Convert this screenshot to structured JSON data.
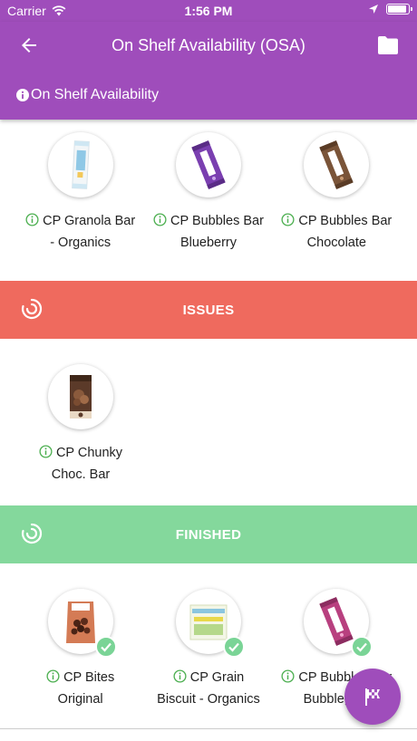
{
  "status_bar": {
    "carrier": "Carrier",
    "time": "1:56 PM",
    "battery_level": 0.9
  },
  "header": {
    "title": "On Shelf Availability (OSA)",
    "subtitle": "On Shelf Availability",
    "icons": [
      "back-arrow-icon",
      "folder-icon",
      "info-icon"
    ]
  },
  "pending": {
    "products": [
      {
        "line1": "CP Granola Bar",
        "line2": "- Organics",
        "image": "granola-bar-image"
      },
      {
        "line1": "CP Bubbles Bar",
        "line2": "Blueberry",
        "image": "bubbles-blueberry-image"
      },
      {
        "line1": "CP Bubbles Bar",
        "line2": "Chocolate",
        "image": "bubbles-chocolate-image"
      }
    ]
  },
  "issues": {
    "label": "ISSUES",
    "color": "#ef6a5e",
    "products": [
      {
        "line1": "CP Chunky",
        "line2": "Choc. Bar",
        "image": "chunky-choc-image"
      }
    ]
  },
  "finished": {
    "label": "FINISHED",
    "color": "#84d89c",
    "products": [
      {
        "line1": "CP Bites",
        "line2": "Original",
        "image": "bites-image"
      },
      {
        "line1": "CP Grain",
        "line2": "Biscuit - Organics",
        "image": "grain-biscuit-image"
      },
      {
        "line1": "CP Bubbles Bar",
        "line2": "Bubblegum",
        "image": "bubbles-bubblegum-image"
      }
    ]
  },
  "colors": {
    "primary": "#9f4dbb",
    "info_green": "#4caf50",
    "check_green": "#7ad496"
  },
  "fab": {
    "icon": "checkered-flag-icon"
  }
}
